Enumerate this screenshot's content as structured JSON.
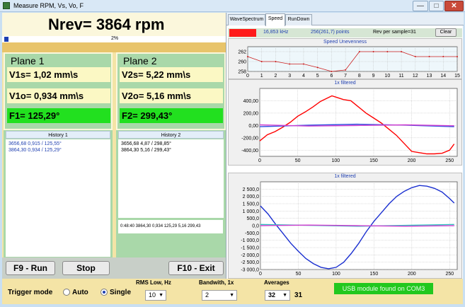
{
  "window": {
    "title": "Measure RPM, Vs, Vo, F",
    "minimize_icon": "minimize-icon",
    "maximize_icon": "maximize-icon",
    "close_icon": "close-icon"
  },
  "rpm": {
    "display": "Nrev= 3864 rpm",
    "progress_percent": 2,
    "progress_text": "2%"
  },
  "plane1": {
    "title": "Plane 1",
    "v1s": "V1s= 1,02 mm\\s",
    "v1o": "V1o= 0,934 mm\\s",
    "f1": "F1= 125,29°"
  },
  "plane2": {
    "title": "Plane 2",
    "v2s": "V2s= 5,22 mm\\s",
    "v2o": "V2o= 5,16 mm\\s",
    "f2": "F2= 299,43°"
  },
  "history1": {
    "title": "History 1",
    "lines": [
      "3656,68 0,915 / 125,55°",
      "3864,30 0,934 / 125,29°"
    ]
  },
  "history2": {
    "title": "History 2",
    "lines": [
      "3656,68 4,87 / 298,85°",
      "3864,30 5,16 / 299,43°"
    ]
  },
  "log": "0:48:40 3864,30 0,934 125,29 5,16 299,43",
  "buttons": {
    "f9": "F9 - Run",
    "stop": "Stop",
    "f10": "F10 - Exit"
  },
  "tabs": [
    "WaveSpectrum",
    "Speed",
    "RunDown"
  ],
  "info": {
    "freq": "16,853 kHz",
    "points": "256(261,7) points",
    "rev": "Rev per sample=31",
    "clear": "Clear",
    "badge_color": "#ff1a1a"
  },
  "chart_data": [
    {
      "type": "line",
      "title": "Speed Unevenness",
      "x": [
        0,
        1,
        2,
        3,
        4,
        5,
        6,
        7,
        8,
        9,
        10,
        11,
        12,
        13,
        14,
        15
      ],
      "xlim": [
        0,
        15
      ],
      "ylim": [
        258,
        263
      ],
      "yticks": [
        258,
        260,
        262
      ],
      "grid": true,
      "series": [
        {
          "color": "#cc2020",
          "values": [
            261,
            260,
            260,
            259.5,
            259.5,
            258.8,
            258,
            258.3,
            262,
            262,
            262,
            262,
            261,
            261,
            261,
            261
          ]
        }
      ]
    },
    {
      "type": "line",
      "title": "1x filtered",
      "xlim": [
        0,
        260
      ],
      "xticks": [
        0,
        50,
        100,
        150,
        200,
        250
      ],
      "ylim": [
        -500,
        600
      ],
      "yticks": [
        -400,
        -200,
        0,
        200,
        400
      ],
      "ytick_labels": [
        "-400,00",
        "-200,00",
        "0,00",
        "200,00",
        "400,00"
      ],
      "grid": true,
      "series": [
        {
          "color": "#ff0000",
          "x": [
            0,
            10,
            20,
            30,
            40,
            50,
            60,
            70,
            80,
            90,
            95,
            100,
            110,
            120,
            130,
            140,
            150,
            160,
            170,
            180,
            190,
            200,
            210,
            220,
            230,
            240,
            250,
            256
          ],
          "values": [
            -250,
            -150,
            -100,
            -30,
            50,
            150,
            220,
            300,
            390,
            450,
            480,
            460,
            420,
            400,
            300,
            200,
            120,
            40,
            -60,
            -160,
            -290,
            -420,
            -440,
            -460,
            -460,
            -450,
            -400,
            -300
          ]
        },
        {
          "color": "#3050e0",
          "x": [
            0,
            64,
            128,
            192,
            256
          ],
          "values": [
            -20,
            5,
            20,
            5,
            -20
          ]
        },
        {
          "color": "#d040d0",
          "x": [
            0,
            64,
            128,
            192,
            256
          ],
          "values": [
            10,
            -10,
            0,
            10,
            -5
          ]
        }
      ]
    },
    {
      "type": "line",
      "title": "1x filtered",
      "xlim": [
        0,
        260
      ],
      "xticks": [
        0,
        50,
        100,
        150,
        200,
        250
      ],
      "ylim": [
        -3000,
        3000
      ],
      "yticks": [
        -3000,
        -2500,
        -2000,
        -1500,
        -1000,
        -500,
        0,
        500,
        1000,
        1500,
        2000,
        2500
      ],
      "ytick_labels": [
        "-3 000,0",
        "-2 500,0",
        "-2 000,0",
        "-1 500,0",
        "-1 000,0",
        "-500,0",
        "0,0",
        "500,0",
        "1 000,0",
        "1 500,0",
        "2 000,0",
        "2 500,0"
      ],
      "grid": true,
      "series": [
        {
          "color": "#1a2fd0",
          "x": [
            0,
            10,
            20,
            30,
            40,
            50,
            60,
            70,
            80,
            90,
            100,
            110,
            120,
            130,
            140,
            150,
            160,
            170,
            180,
            190,
            200,
            210,
            220,
            230,
            240,
            250,
            256
          ],
          "values": [
            1350,
            800,
            100,
            -550,
            -1200,
            -1750,
            -2250,
            -2600,
            -2850,
            -2950,
            -2850,
            -2500,
            -1900,
            -1200,
            -400,
            300,
            900,
            1500,
            2000,
            2350,
            2600,
            2750,
            2700,
            2550,
            2300,
            1850,
            1550
          ]
        },
        {
          "color": "#30c0c0",
          "x": [
            0,
            64,
            128,
            192,
            256
          ],
          "values": [
            80,
            20,
            -40,
            20,
            80
          ]
        },
        {
          "color": "#d040d0",
          "x": [
            0,
            64,
            128,
            192,
            256
          ],
          "values": [
            0,
            40,
            0,
            -40,
            0
          ]
        }
      ]
    }
  ],
  "controls": {
    "trigger_label": "Trigger mode",
    "auto": "Auto",
    "single": "Single",
    "rms_label": "RMS Low, Hz",
    "rms_value": "10",
    "bw_label": "Bandwith, 1x",
    "bw_value": "2",
    "avg_label": "Averages",
    "avg_value": "32",
    "avg_count": "31",
    "usb_status": "USB module found on COM3",
    "combo_arrow_icon": "chevron-down-icon"
  }
}
